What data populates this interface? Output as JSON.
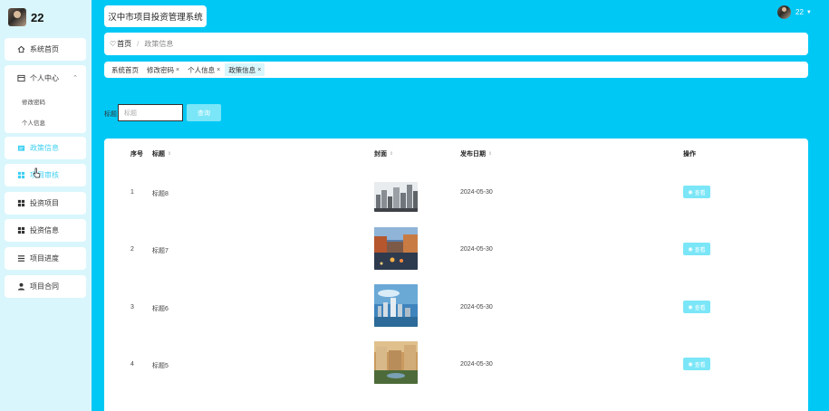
{
  "sidebar": {
    "username": "22",
    "items": [
      {
        "label": "系统首页",
        "icon": "home-icon"
      },
      {
        "label": "个人中心",
        "icon": "profile-icon"
      },
      {
        "label": "修改密码"
      },
      {
        "label": "个人信息"
      },
      {
        "label": "政策信息",
        "icon": "policy-icon"
      },
      {
        "label": "项目审核",
        "icon": "grid-icon"
      },
      {
        "label": "投资项目",
        "icon": "grid-icon"
      },
      {
        "label": "投资信息",
        "icon": "grid-icon"
      },
      {
        "label": "项目进度",
        "icon": "list-icon"
      },
      {
        "label": "项目合同",
        "icon": "user-icon"
      }
    ]
  },
  "header": {
    "app_title": "汉中市项目投资管理系统",
    "user": "22"
  },
  "breadcrumb": {
    "home": "首页",
    "current": "政策信息"
  },
  "tags": [
    {
      "label": "系统首页"
    },
    {
      "label": "修改密码"
    },
    {
      "label": "个人信息"
    },
    {
      "label": "政策信息"
    }
  ],
  "search": {
    "label": "标题",
    "placeholder": "标题",
    "button": "查询"
  },
  "table": {
    "columns": [
      "序号",
      "标题",
      "封面",
      "发布日期",
      "操作"
    ],
    "rows": [
      {
        "index": "1",
        "title": "标题8",
        "date": "2024-05-30",
        "action": "查看"
      },
      {
        "index": "2",
        "title": "标题7",
        "date": "2024-05-30",
        "action": "查看"
      },
      {
        "index": "3",
        "title": "标题6",
        "date": "2024-05-30",
        "action": "查看"
      },
      {
        "index": "4",
        "title": "标题5",
        "date": "2024-05-30",
        "action": "查看"
      }
    ]
  },
  "colors": {
    "accent": "#00c8f5",
    "sidebar_bg": "#d9f6fc",
    "button": "#7ae6f7"
  }
}
